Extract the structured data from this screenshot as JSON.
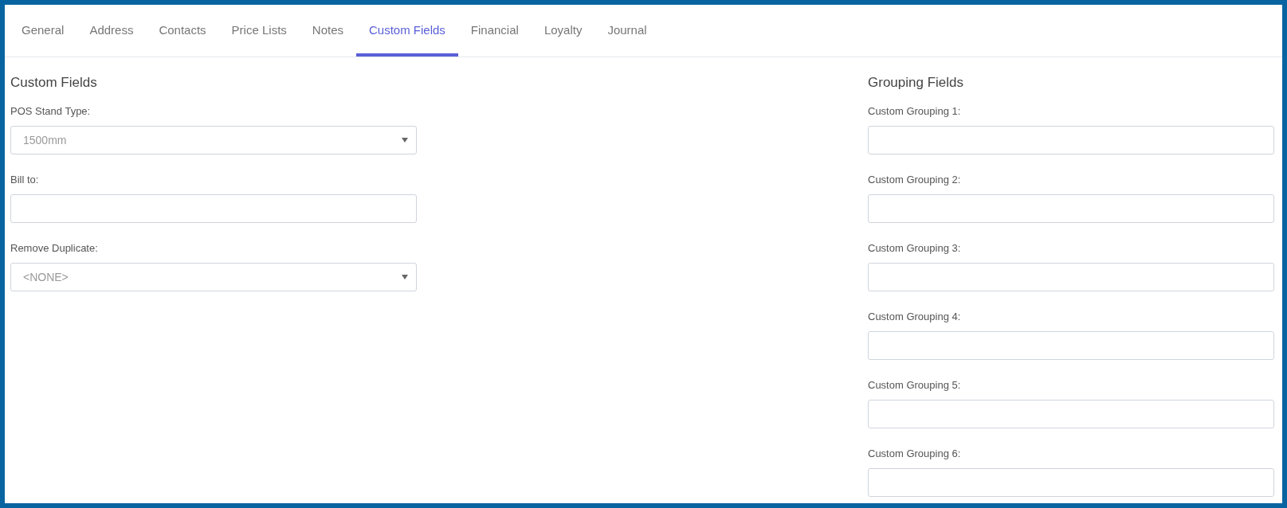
{
  "tabs": [
    {
      "label": "General",
      "selected": false
    },
    {
      "label": "Address",
      "selected": false
    },
    {
      "label": "Contacts",
      "selected": false
    },
    {
      "label": "Price Lists",
      "selected": false
    },
    {
      "label": "Notes",
      "selected": false
    },
    {
      "label": "Custom Fields",
      "selected": true
    },
    {
      "label": "Financial",
      "selected": false
    },
    {
      "label": "Loyalty",
      "selected": false
    },
    {
      "label": "Journal",
      "selected": false
    }
  ],
  "custom_fields": {
    "title": "Custom Fields",
    "fields": [
      {
        "label": "POS Stand Type:",
        "kind": "select",
        "value": "1500mm"
      },
      {
        "label": "Bill to:",
        "kind": "text"
      },
      {
        "label": "Remove Duplicate:",
        "kind": "select",
        "value": "<NONE>"
      }
    ]
  },
  "grouping_fields": {
    "title": "Grouping Fields",
    "fields": [
      {
        "label": "Custom Grouping 1:",
        "kind": "text"
      },
      {
        "label": "Custom Grouping 2:",
        "kind": "text"
      },
      {
        "label": "Custom Grouping 3:",
        "kind": "text"
      },
      {
        "label": "Custom Grouping 4:",
        "kind": "text"
      },
      {
        "label": "Custom Grouping 5:",
        "kind": "text"
      },
      {
        "label": "Custom Grouping 6:",
        "kind": "text"
      }
    ]
  }
}
